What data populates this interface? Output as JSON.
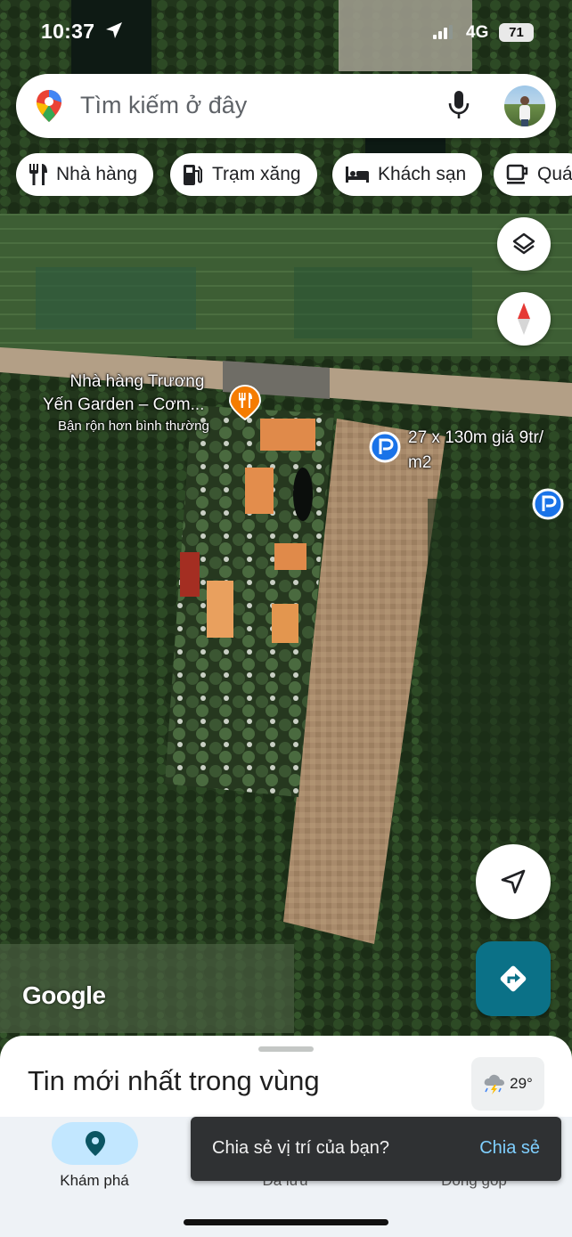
{
  "status_bar": {
    "time": "10:37",
    "network": "4G",
    "battery": "71"
  },
  "search": {
    "placeholder": "Tìm kiếm ở đây"
  },
  "chips": [
    {
      "label": "Nhà hàng",
      "icon": "fork-knife-icon"
    },
    {
      "label": "Trạm xăng",
      "icon": "gas-station-icon"
    },
    {
      "label": "Khách sạn",
      "icon": "bed-icon"
    },
    {
      "label": "Quá",
      "icon": "coffee-cup-icon"
    }
  ],
  "map": {
    "poi": {
      "name_line1": "Nhà hàng Trương",
      "name_line2": "Yến Garden – Cơm...",
      "status": "Bận rộn hơn bình thường",
      "icon": "restaurant-pin-icon",
      "color": "#f57c00"
    },
    "parking_label": {
      "line1": "27 x 130m giá 9tr/",
      "line2": "m2",
      "icon": "parking-pin-icon",
      "color": "#1a73e8"
    },
    "attribution": "Google"
  },
  "controls": {
    "layers_icon": "layers-icon",
    "compass_icon": "compass-icon",
    "my_location_icon": "navigation-arrow-icon",
    "directions_icon": "directions-icon",
    "directions_color": "#0b7187"
  },
  "sheet": {
    "title": "Tin mới nhất trong vùng",
    "weather": {
      "temp": "29°",
      "icon": "thunderstorm-icon"
    }
  },
  "nav": {
    "items": [
      {
        "label": "Khám phá",
        "icon": "explore-pin-icon",
        "active": true
      },
      {
        "label": "Đã lưu",
        "icon": "bookmark-icon"
      },
      {
        "label": "Đóng góp",
        "icon": "add-circle-icon"
      }
    ]
  },
  "toast": {
    "text": "Chia sẻ vị trí của bạn?",
    "action": "Chia sẻ"
  }
}
